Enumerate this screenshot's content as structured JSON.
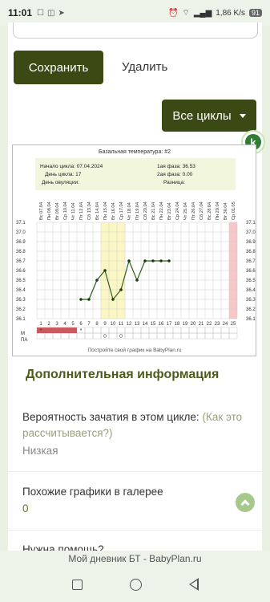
{
  "status": {
    "time": "11:01",
    "speed": "1,86 K/s",
    "battery": "91"
  },
  "actions": {
    "save": "Сохранить",
    "delete": "Удалить",
    "all_cycles": "Все циклы"
  },
  "chart_info": {
    "start_label": "Начало цикла: 07.04.2024",
    "day_label": "День цикла: 17",
    "ovulation_label": "День овуляции:",
    "phase1_label": "1ая фаза: 36.53",
    "phase2_label": "2ая фаза: 0.00",
    "diff_label": "Разница:",
    "footer": "Постройте свой график на BabyPlan.ru",
    "row_m": "М",
    "row_pa": "ПА"
  },
  "chart_data": {
    "type": "line",
    "title": "Базальная температура: #2",
    "dates": [
      "Вс 07.04",
      "Пн 08.04",
      "Вт 09.04",
      "Ср 10.04",
      "Чт 11.04",
      "Пт 12.04",
      "Сб 13.04",
      "Вс 14.04",
      "Пн 15.04",
      "Вт 16.04",
      "Ср 17.04",
      "Чт 18.04",
      "Пт 19.04",
      "Сб 20.04",
      "Вс 21.04",
      "Пн 22.04",
      "Вт 23.04",
      "Ср 24.04",
      "Чт 25.04",
      "Пт 26.04",
      "Сб 27.04",
      "Вс 28.04",
      "Пн 29.04",
      "Вт 30.04",
      "Ср 01.05"
    ],
    "days": [
      1,
      2,
      3,
      4,
      5,
      6,
      7,
      8,
      9,
      10,
      11,
      12,
      13,
      14,
      15,
      16,
      17,
      18,
      19,
      20,
      21,
      22,
      23,
      24,
      25
    ],
    "series": [
      {
        "values": [
          null,
          null,
          null,
          null,
          null,
          36.3,
          36.3,
          36.5,
          36.6,
          36.3,
          36.4,
          36.7,
          36.5,
          36.7,
          36.7,
          36.7,
          36.7,
          null,
          null,
          null,
          null,
          null,
          null,
          null,
          null
        ]
      }
    ],
    "ylim": [
      36.1,
      37.1
    ],
    "yticks": [
      "37.1",
      "37.0",
      "36.9",
      "36.8",
      "36.7",
      "36.6",
      "36.5",
      "36.4",
      "36.3",
      "36.2",
      "36.1"
    ],
    "highlight_days": [
      9,
      10,
      11
    ],
    "pink_day": 25,
    "menstruation_days": [
      1,
      2,
      3,
      4,
      5
    ],
    "marker_m": [
      "*",
      "",
      "",
      "",
      "",
      "*"
    ],
    "marker_pa_days": [
      9,
      11
    ]
  },
  "info": {
    "section_title": "Дополнительная информация",
    "conception_label": "Вероятность зачатия в этом цикле:",
    "conception_link": "(Как это рассчитывается?)",
    "conception_value": "Низкая",
    "gallery_label": "Похожие графики в галерее",
    "gallery_value": "0",
    "help_label": "Нужна помощь?"
  },
  "footer": {
    "url": "Мой дневник БТ - BabyPlan.ru"
  }
}
